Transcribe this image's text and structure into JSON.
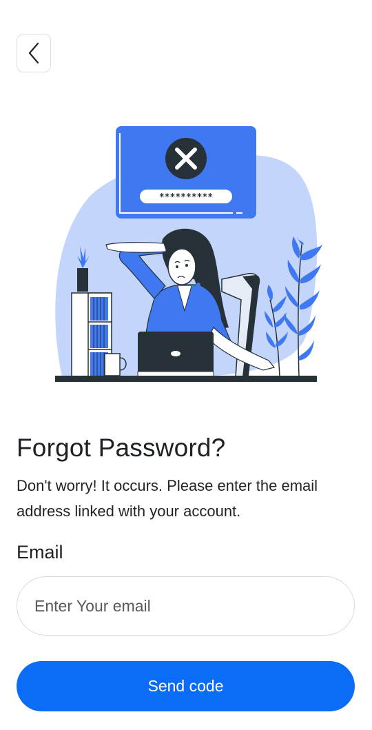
{
  "header": {
    "back_icon": "chevron-left-icon"
  },
  "illustration": {
    "password_mask": "**********",
    "error_icon": "x-circle-icon"
  },
  "main": {
    "title": "Forgot Password?",
    "subtitle": "Don't worry! It occurs. Please enter the email address linked with your account.",
    "email_label": "Email",
    "email_placeholder": "Enter Your email",
    "email_value": "",
    "send_button_label": "Send code"
  },
  "colors": {
    "accent": "#0b6cf7",
    "illustration_blue": "#3f78f0",
    "illustration_light_blue": "#c3d5fb",
    "dark": "#263238"
  }
}
